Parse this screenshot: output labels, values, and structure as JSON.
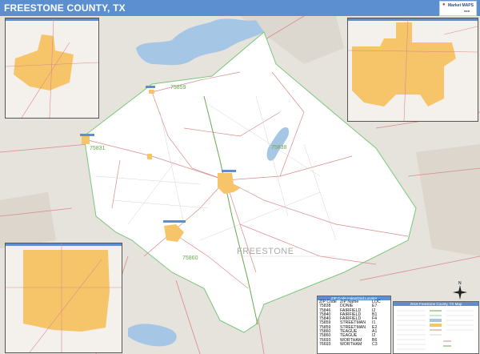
{
  "header": {
    "title": "FREESTONE COUNTY, TX",
    "logo_text": "Market MAPS"
  },
  "map": {
    "county_label": "FREESTONE",
    "zip_labels": [
      {
        "name": "zip-75859-north",
        "text": "75859"
      },
      {
        "name": "zip-75831",
        "text": "75831"
      },
      {
        "name": "zip-75838",
        "text": "75838"
      },
      {
        "name": "zip-75860",
        "text": "75860"
      }
    ],
    "colors": {
      "water": "#a6c6e6",
      "county": "#ffffff",
      "outside": "#e6e2dc",
      "city": "#f6c56a",
      "road": "#d98a8a",
      "zip_border": "#7ac87a",
      "header": "#5b8fd0"
    }
  },
  "zip_table": {
    "title": "ZIP Code Index/Grid Locator",
    "columns": [
      "ZIP Code",
      "ZIP Name",
      "LOC"
    ],
    "rows": [
      [
        "75838",
        "DONIE",
        "E7"
      ],
      [
        "75846",
        "FAIRFIELD",
        "I2"
      ],
      [
        "75840",
        "FAIRFIELD",
        "B1"
      ],
      [
        "75840",
        "FAIRFIELD",
        "F4"
      ],
      [
        "75859",
        "STREETMAN",
        "I1"
      ],
      [
        "75859",
        "STREETMAN",
        "E2"
      ],
      [
        "75860",
        "TEAGUE",
        "A1"
      ],
      [
        "75860",
        "TEAGUE",
        "I2"
      ],
      [
        "76693",
        "WORTHAM",
        "B6"
      ],
      [
        "76693",
        "WORTHAM",
        "C3"
      ]
    ]
  },
  "legend": {
    "title": "2016 Freestone County, TX Map"
  }
}
